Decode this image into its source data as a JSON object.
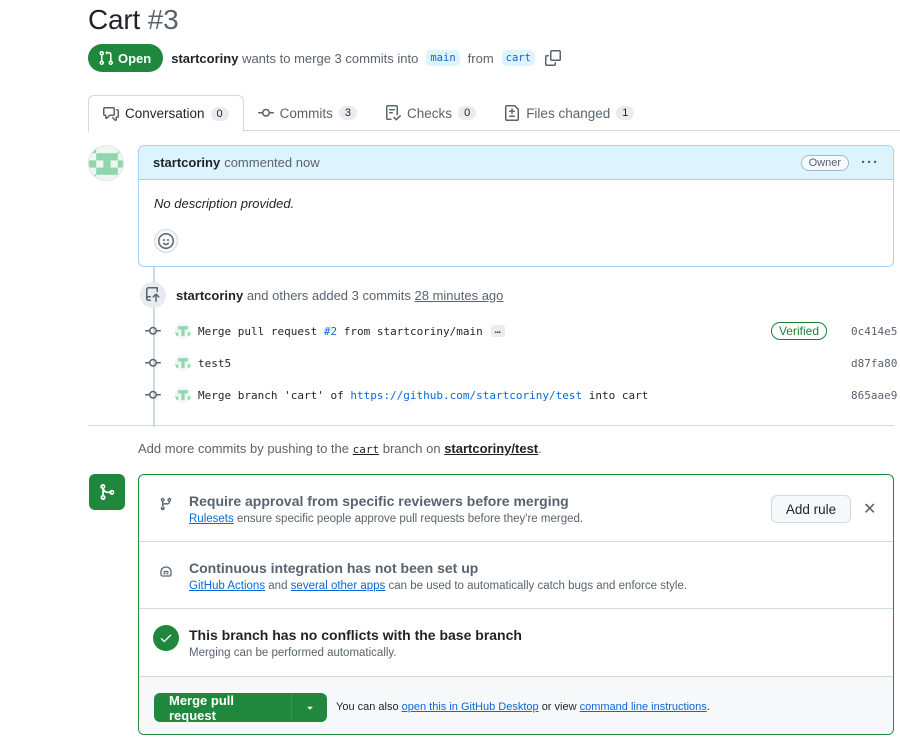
{
  "pr": {
    "title": "Cart",
    "number": "#3",
    "state": "Open",
    "author": "startcoriny",
    "meta_middle": "wants to merge 3 commits into",
    "base_branch": "main",
    "meta_from": "from",
    "head_branch": "cart"
  },
  "tabs": [
    {
      "label": "Conversation",
      "count": "0"
    },
    {
      "label": "Commits",
      "count": "3"
    },
    {
      "label": "Checks",
      "count": "0"
    },
    {
      "label": "Files changed",
      "count": "1"
    }
  ],
  "comment": {
    "author": "startcoriny",
    "action": "commented now",
    "role": "Owner",
    "body": "No description provided."
  },
  "timeline": {
    "actor": "startcoriny",
    "action": "and others added 3 commits",
    "time": "28 minutes ago"
  },
  "commits": [
    {
      "msg_pre": "Merge pull request ",
      "msg_link": "#2",
      "msg_post": " from startcoriny/main",
      "verified": "Verified",
      "sha": "0c414e5"
    },
    {
      "msg_pre": "test5",
      "sha": "d87fa80"
    },
    {
      "msg_pre": "Merge branch 'cart' of ",
      "msg_link": "https://github.com/startcoriny/test",
      "msg_post": " into cart",
      "sha": "865aae9"
    }
  ],
  "push_hint": {
    "pre": "Add more commits by pushing to the",
    "branch": "cart",
    "mid": "branch on",
    "repo": "startcoriny/test",
    "end": "."
  },
  "merge": {
    "rule_title": "Require approval from specific reviewers before merging",
    "rule_link": "Rulesets",
    "rule_text": "ensure specific people approve pull requests before they're merged.",
    "add_rule": "Add rule",
    "ci_title": "Continuous integration has not been set up",
    "ci_link1": "GitHub Actions",
    "ci_and": "and",
    "ci_link2": "several other apps",
    "ci_text": "can be used to automatically catch bugs and enforce style.",
    "conflict_title": "This branch has no conflicts with the base branch",
    "conflict_text": "Merging can be performed automatically.",
    "button": "Merge pull request",
    "also_pre": "You can also",
    "also_link1": "open this in GitHub Desktop",
    "also_mid": "or view",
    "also_link2": "command line instructions",
    "also_end": "."
  },
  "colors": {
    "success": "#1f883d",
    "link": "#0969da",
    "comment_header": "#ddf4ff"
  }
}
